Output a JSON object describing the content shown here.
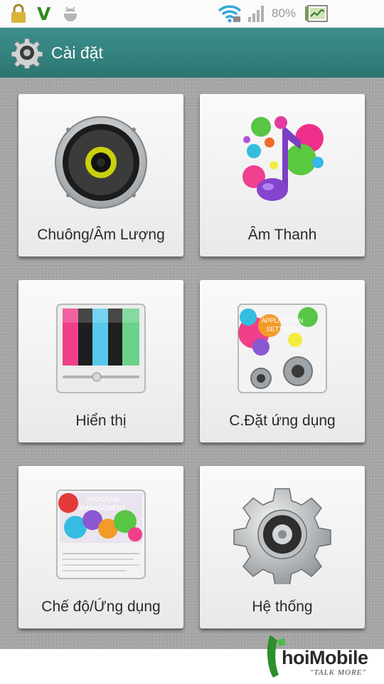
{
  "status_bar": {
    "carrier_mark": "V",
    "battery_percent": "80%",
    "icons": [
      "lock-icon",
      "carrier-v-icon",
      "android-debug-icon",
      "wifi-icon",
      "signal-icon",
      "battery-icon"
    ]
  },
  "header": {
    "title": "Cài đặt",
    "icon": "settings-gear-icon"
  },
  "tiles": [
    {
      "label": "Chuông/Âm Lượng",
      "icon": "speaker-icon"
    },
    {
      "label": "Âm Thanh",
      "icon": "music-note-icon"
    },
    {
      "label": "Hiển thị",
      "icon": "display-bars-icon"
    },
    {
      "label": "C.Đặt ứng dụng",
      "icon": "application-settings-icon",
      "icon_text_1": "APPLICATION",
      "icon_text_2": "SETTINGS"
    },
    {
      "label": "Chế độ/Ứng dụng",
      "icon": "program-management-icon",
      "icon_text_1": "PROGRAM",
      "icon_text_2": "MANAGEMENT"
    },
    {
      "label": "Hệ thống",
      "icon": "system-gear-icon"
    }
  ],
  "watermark": {
    "brand": "hoiMobile",
    "tagline": "\"TALK MORE\"",
    "trademark": "TM"
  },
  "colors": {
    "header_teal": "#2d7672",
    "background_gray": "#a6a6a6",
    "tile_white": "#f5f5f5",
    "carrier_green": "#2f8a1e"
  }
}
